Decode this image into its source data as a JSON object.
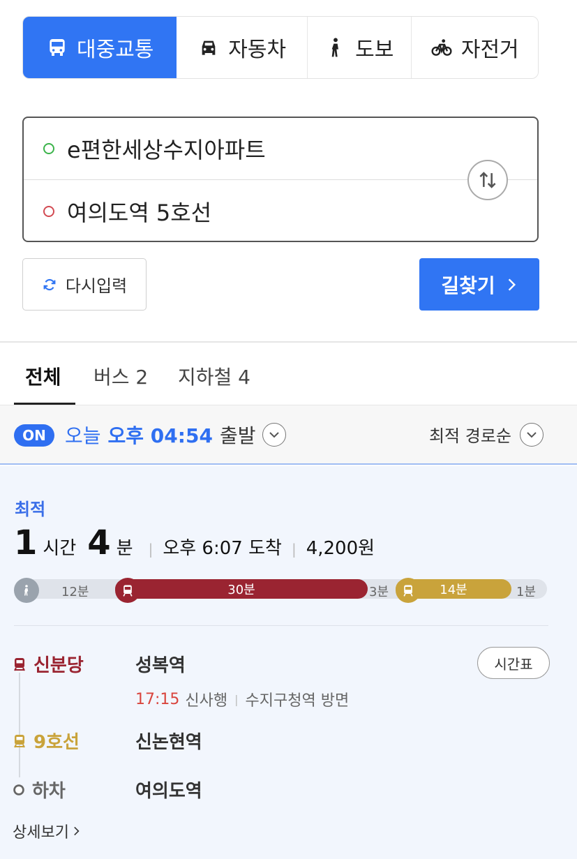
{
  "modes": [
    {
      "label": "대중교통",
      "icon": "bus-icon",
      "active": true
    },
    {
      "label": "자동차",
      "icon": "car-icon",
      "active": false
    },
    {
      "label": "도보",
      "icon": "walk-icon",
      "active": false
    },
    {
      "label": "자전거",
      "icon": "bike-icon",
      "active": false
    }
  ],
  "route": {
    "origin": "e편한세상수지아파트",
    "destination": "여의도역 5호선"
  },
  "buttons": {
    "reset": "다시입력",
    "search": "길찾기"
  },
  "result_tabs": [
    "전체",
    "버스 2",
    "지하철 4"
  ],
  "filter": {
    "badge": "ON",
    "day": "오늘",
    "time": "오후 04:54",
    "suffix": "출발",
    "sort": "최적 경로순"
  },
  "best_route": {
    "tag": "최적",
    "hours": "1",
    "hours_unit": "시간",
    "minutes": "4",
    "minutes_unit": "분",
    "arrival": "오후 6:07 도착",
    "fare": "4,200원",
    "segments": {
      "walk1": "12분",
      "line1": "30분",
      "transfer": "3분",
      "line2": "14분",
      "walk2": "1분"
    },
    "colors": {
      "line_red": "#9a2431",
      "line_yellow": "#c9a33b",
      "accent": "#3075f3"
    },
    "steps": [
      {
        "line": "신분당",
        "station": "성복역"
      },
      {
        "line": "9호선",
        "station": "신논현역"
      },
      {
        "line": "하차",
        "station": "여의도역"
      }
    ],
    "departure": {
      "time": "17:15",
      "direction": "신사행",
      "platform": "수지구청역 방면"
    },
    "timetable": "시간표",
    "detail": "상세보기"
  }
}
